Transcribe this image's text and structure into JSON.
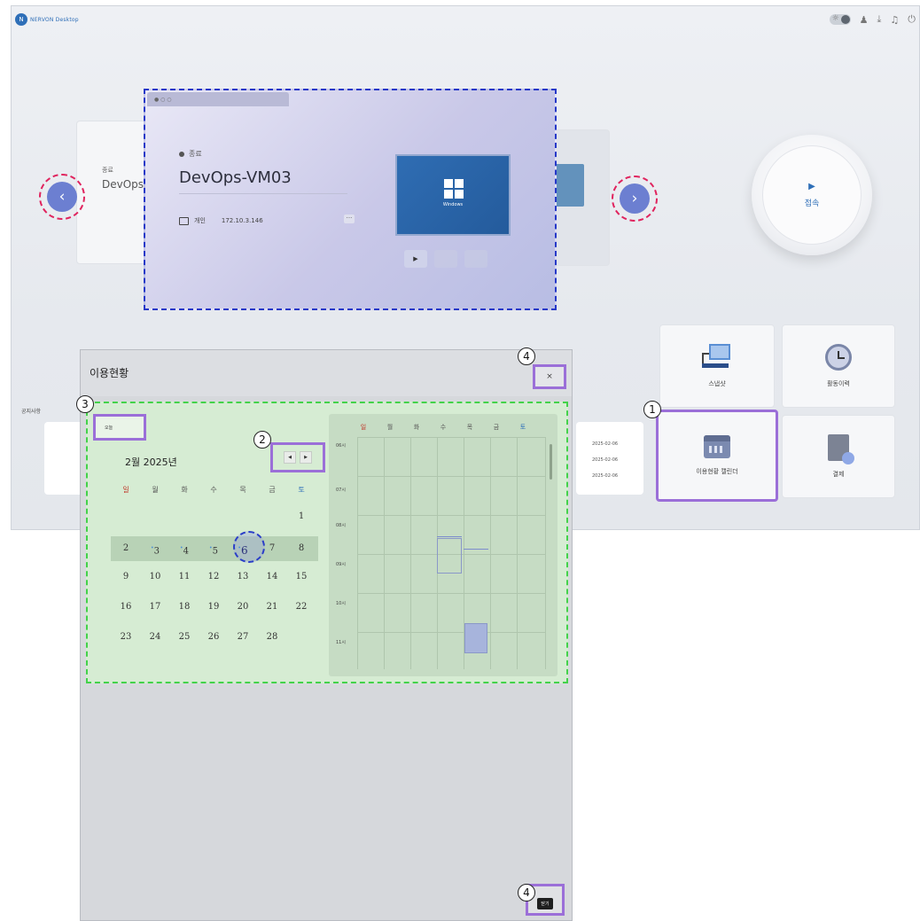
{
  "app": {
    "logo_text": "NERVON Desktop",
    "logo_badge": "N"
  },
  "top_icons": [
    "theme-toggle",
    "user-icon",
    "download-icon",
    "bell-icon",
    "logout-icon"
  ],
  "carousel": {
    "left_card": {
      "status": "종료",
      "name": "DevOps"
    },
    "main_card": {
      "status": "종료",
      "vm_name": "DevOps-VM03",
      "ip_label": "개인",
      "ip": "172.10.3.146",
      "more": "···",
      "preview_label": "Windows",
      "play": "▶"
    },
    "prev": "‹",
    "next": "›"
  },
  "connect": {
    "label": "접속",
    "play": "▶"
  },
  "tiles": {
    "snapshot": "스냅샷",
    "history": "활동이력",
    "usage_calendar": "이용현황 캘린더",
    "payment": "결제"
  },
  "notice": {
    "label": "공지사항",
    "dates": [
      "2025-02-06",
      "2025-02-06",
      "2025-02-06"
    ]
  },
  "dialog": {
    "title": "이용현황",
    "close": "×",
    "today_button": "오늘",
    "month_label": "2월 2025년",
    "prev": "◀",
    "next": "▶",
    "weekdays": [
      "일",
      "월",
      "화",
      "수",
      "목",
      "금",
      "토"
    ],
    "weeks": [
      [
        "",
        "",
        "",
        "",
        "",
        "",
        "1"
      ],
      [
        "2",
        "3",
        "4",
        "5",
        "6",
        "7",
        "8"
      ],
      [
        "9",
        "10",
        "11",
        "12",
        "13",
        "14",
        "15"
      ],
      [
        "16",
        "17",
        "18",
        "19",
        "20",
        "21",
        "22"
      ],
      [
        "23",
        "24",
        "25",
        "26",
        "27",
        "28",
        ""
      ]
    ],
    "selected_day": "6",
    "days_with_usage": [
      "3",
      "4",
      "5",
      "6"
    ],
    "week_view": {
      "times": [
        "06시",
        "07시",
        "08시",
        "09시",
        "10시",
        "11시"
      ]
    },
    "footer_close": "닫기"
  },
  "markers": [
    "1",
    "2",
    "3",
    "4",
    "4"
  ],
  "colors": {
    "accent": "#2f6fb8",
    "callout_box": "#9b6fd8",
    "main_card_outline": "#2638c8",
    "nav_outline": "#e0245e",
    "calendar_outline": "#43d24a",
    "sunday": "#c0392b",
    "saturday": "#2f6fb8"
  }
}
